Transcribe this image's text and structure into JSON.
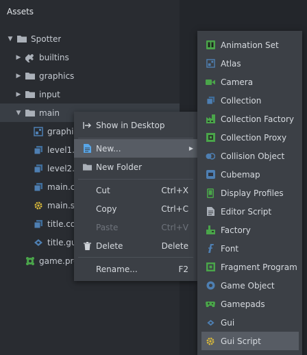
{
  "panel": {
    "title": "Assets"
  },
  "tree": [
    {
      "label": "Spotter",
      "expander": "expanded",
      "icon": "folder-icon"
    },
    {
      "label": "builtins",
      "expander": "collapsed",
      "icon": "puzzle-icon"
    },
    {
      "label": "graphics",
      "expander": "collapsed",
      "icon": "folder-icon"
    },
    {
      "label": "input",
      "expander": "collapsed",
      "icon": "folder-icon"
    },
    {
      "label": "main",
      "expander": "expanded",
      "icon": "folder-icon"
    },
    {
      "label": "graphic",
      "icon": "atlas-icon"
    },
    {
      "label": "level1.c",
      "icon": "collection-icon"
    },
    {
      "label": "level2.c",
      "icon": "collection-icon"
    },
    {
      "label": "main.co",
      "icon": "collection-icon"
    },
    {
      "label": "main.sc",
      "icon": "script-icon"
    },
    {
      "label": "title.col",
      "icon": "collection-icon"
    },
    {
      "label": "title.gu",
      "icon": "gui-icon"
    },
    {
      "label": "game.pro",
      "icon": "project-icon"
    }
  ],
  "context_menu": {
    "items": [
      {
        "label": "Show in Desktop",
        "icon": "show-desktop-icon"
      },
      {
        "label": "New...",
        "icon": "new-file-icon",
        "submenu": true
      },
      {
        "label": "New Folder",
        "icon": "folder-icon"
      },
      {
        "label": "Cut",
        "shortcut": "Ctrl+X"
      },
      {
        "label": "Copy",
        "shortcut": "Ctrl+C"
      },
      {
        "label": "Paste",
        "shortcut": "Ctrl+V",
        "disabled": true
      },
      {
        "label": "Delete",
        "icon": "trash-icon",
        "shortcut": "Delete"
      },
      {
        "label": "Rename...",
        "shortcut": "F2"
      }
    ]
  },
  "new_menu": {
    "items": [
      {
        "label": "Animation Set",
        "icon": "animation-set-icon"
      },
      {
        "label": "Atlas",
        "icon": "atlas-icon"
      },
      {
        "label": "Camera",
        "icon": "camera-icon"
      },
      {
        "label": "Collection",
        "icon": "collection-icon"
      },
      {
        "label": "Collection Factory",
        "icon": "collection-factory-icon"
      },
      {
        "label": "Collection Proxy",
        "icon": "collection-proxy-icon"
      },
      {
        "label": "Collision Object",
        "icon": "collision-object-icon"
      },
      {
        "label": "Cubemap",
        "icon": "cubemap-icon"
      },
      {
        "label": "Display Profiles",
        "icon": "display-profiles-icon"
      },
      {
        "label": "Editor Script",
        "icon": "editor-script-icon"
      },
      {
        "label": "Factory",
        "icon": "factory-icon"
      },
      {
        "label": "Font",
        "icon": "font-icon"
      },
      {
        "label": "Fragment Program",
        "icon": "fragment-program-icon"
      },
      {
        "label": "Game Object",
        "icon": "game-object-icon"
      },
      {
        "label": "Gamepads",
        "icon": "gamepads-icon"
      },
      {
        "label": "Gui",
        "icon": "gui-icon"
      },
      {
        "label": "Gui Script",
        "icon": "gui-script-icon",
        "highlighted": true
      }
    ]
  },
  "colors": {
    "green": "#4aa54a",
    "blue": "#4e7fb2",
    "yellow": "#d9b93a",
    "highlight": "#575c64"
  }
}
